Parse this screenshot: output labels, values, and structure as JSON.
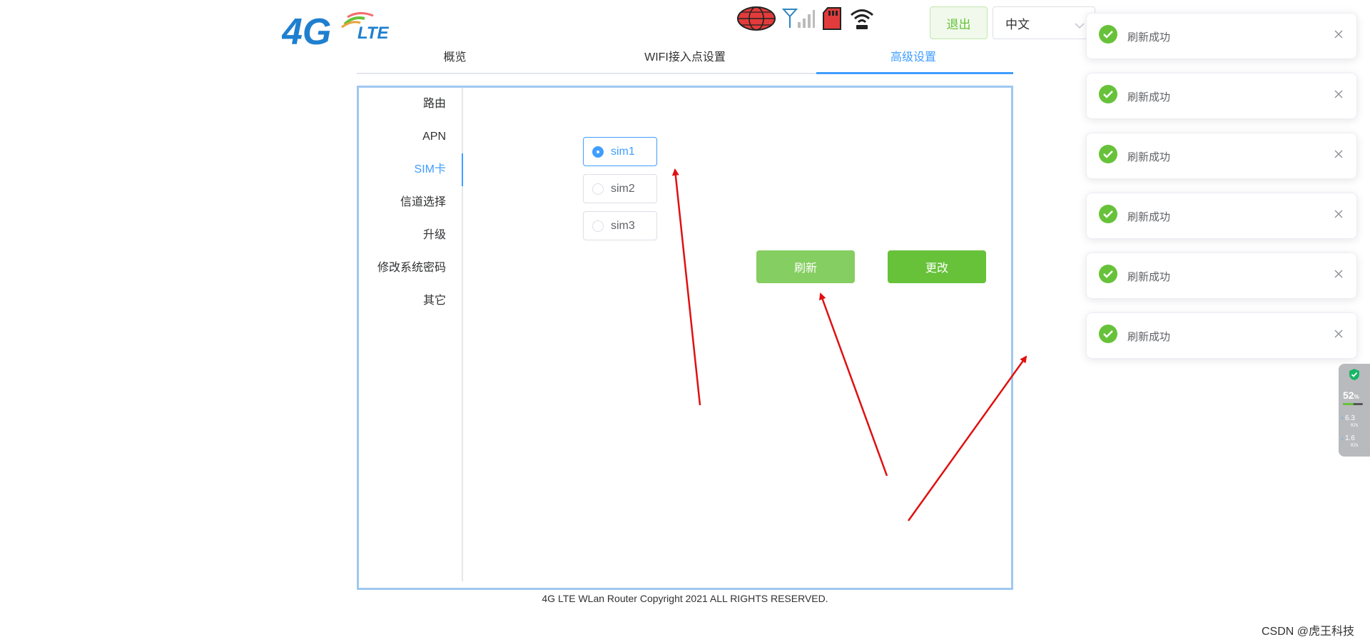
{
  "header": {
    "logo_main": "4G",
    "logo_sub": "LTE",
    "status_icons": [
      "globe-icon",
      "signal-antenna-icon",
      "sd-card-icon",
      "wifi-icon"
    ],
    "logout_label": "退出",
    "language_value": "中文"
  },
  "tabs": [
    {
      "label": "概览"
    },
    {
      "label": "WIFI接入点设置"
    },
    {
      "label": "高级设置",
      "active": true
    }
  ],
  "sidebar": {
    "items": [
      {
        "label": "路由"
      },
      {
        "label": "APN"
      },
      {
        "label": "SIM卡",
        "active": true
      },
      {
        "label": "信道选择"
      },
      {
        "label": "升级"
      },
      {
        "label": "修改系统密码"
      },
      {
        "label": "其它"
      }
    ]
  },
  "sim": {
    "options": [
      {
        "label": "sim1",
        "checked": true
      },
      {
        "label": "sim2",
        "checked": false
      },
      {
        "label": "sim3",
        "checked": false
      }
    ],
    "refresh_label": "刷新",
    "change_label": "更改"
  },
  "footer": {
    "copyright": "4G LTE WLan Router Copyright 2021 ALL RIGHTS RESERVED."
  },
  "notifications": [
    {
      "message": "刷新成功"
    },
    {
      "message": "刷新成功"
    },
    {
      "message": "刷新成功"
    },
    {
      "message": "刷新成功"
    },
    {
      "message": "刷新成功"
    },
    {
      "message": "刷新成功"
    }
  ],
  "speed_widget": {
    "percent": "52",
    "percent_unit": "%",
    "percent_value": 0.52,
    "upload": "6.3",
    "upload_unit": "K/s",
    "download": "1.6",
    "download_unit": "K/s"
  },
  "watermark": "CSDN @虎王科技",
  "colors": {
    "primary": "#409eff",
    "success": "#67c23a",
    "success_light": "#85ce61",
    "annotation_arrow": "#e01010"
  }
}
